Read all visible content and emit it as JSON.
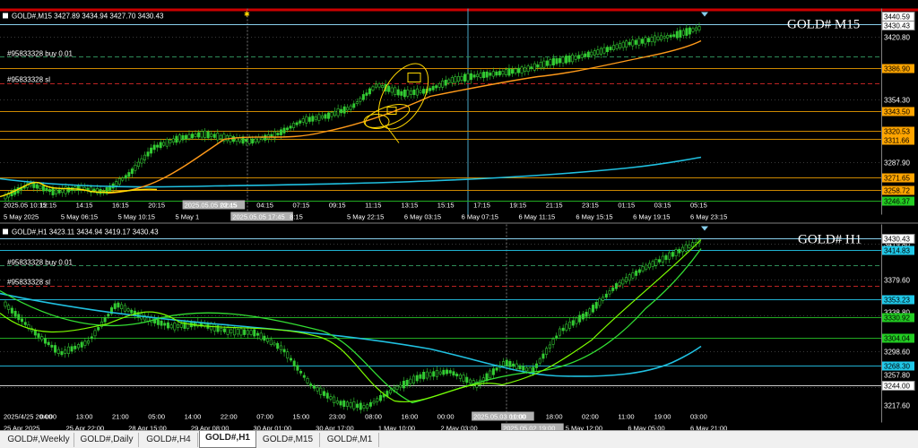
{
  "colors": {
    "background": "#000000",
    "grid": "#3a3a3a",
    "candle": "#33cc33",
    "ma_fast": "#7cfc00",
    "ma_orange": "#ff9a1a",
    "ma_cyan": "#20c0e0",
    "price_tag": "#ffffff",
    "tab_bar": "#f0f0f0"
  },
  "top_chart": {
    "info_text": "GOLD#,M15  3427.89 3434.94 3427.70 3430.43",
    "symbol_label": "GOLD# M15",
    "order_buy": "#95833328 buy 0.01",
    "order_sl": "#95833328 sl",
    "y_labels": [
      "3420.80",
      "3354.30",
      "3287.90"
    ],
    "price_tags": [
      {
        "value": "3440.59",
        "style": "white-box"
      },
      {
        "value": "3430.43",
        "style": "white-box"
      },
      {
        "value": "3386.90",
        "style": "orange"
      },
      {
        "value": "3343.50",
        "style": "orange"
      },
      {
        "value": "3320.53",
        "style": "orange"
      },
      {
        "value": "3311.66",
        "style": "orange"
      },
      {
        "value": "3271.65",
        "style": "orange"
      },
      {
        "value": "3258.72",
        "style": "orange"
      },
      {
        "value": "3246.37",
        "style": "green"
      }
    ],
    "x_labels_upper": [
      "2025.05 10:15",
      "12:15",
      "14:15",
      "16:15",
      "20:15",
      "2025.05.05 23:45",
      "02:15",
      "04:15",
      "07:15",
      "09:15",
      "11:15",
      "13:15",
      "15:15",
      "17:15",
      "19:15",
      "21:15",
      "23:15",
      "01:15",
      "03:15",
      "05:15"
    ],
    "x_labels_lower": [
      "5 May 2025",
      "5 May 06:15",
      "5 May 10:15",
      "5 May 1",
      "2025.05.05 17:45",
      "8:15",
      "5 May 22:15",
      "6 May 03:15",
      "6 May 07:15",
      "6 May 11:15",
      "6 May 15:15",
      "6 May 19:15",
      "6 May 23:15"
    ]
  },
  "bottom_chart": {
    "info_text": "GOLD#,H1  3423.11 3434.94 3419.17 3430.43",
    "symbol_label": "GOLD# H1",
    "order_buy": "#95833328 buy 0.01",
    "order_sl": "#95833328 sl",
    "y_labels": [
      "3419.80",
      "3379.60",
      "3338.80",
      "3298.60",
      "3257.80",
      "3217.60"
    ],
    "price_tags": [
      {
        "value": "3430.43",
        "style": "white-box"
      },
      {
        "value": "3414.83",
        "style": "cyan"
      },
      {
        "value": "3353.23",
        "style": "cyan"
      },
      {
        "value": "3330.92",
        "style": "green"
      },
      {
        "value": "3304.04",
        "style": "green"
      },
      {
        "value": "3268.30",
        "style": "cyan"
      },
      {
        "value": "3244.00",
        "style": "white-box"
      }
    ],
    "x_labels_upper": [
      "2025/4/25 20:00",
      "04:00",
      "13:00",
      "21:00",
      "05:00",
      "14:00",
      "22:00",
      "07:00",
      "15:00",
      "23:00",
      "08:00",
      "16:00",
      "00:00",
      "2025.05.03 01:00",
      "10:00",
      "18:00",
      "02:00",
      "11:00",
      "19:00",
      "03:00"
    ],
    "x_labels_lower": [
      "25 Apr 2025",
      "25 Apr 22:00",
      "28 Apr 15:00",
      "29 Apr 08:00",
      "30 Apr 01:00",
      "30 Apr 17:00",
      "1 May 10:00",
      "2 May 03:00",
      "2025.05.02 19:00",
      "5 May 12:00",
      "6 May 05:00",
      "6 May 21:00"
    ]
  },
  "tabs": [
    {
      "label": "GOLD#,Weekly",
      "active": false
    },
    {
      "label": "GOLD#,Daily",
      "active": false
    },
    {
      "label": "GOLD#,H4",
      "active": false
    },
    {
      "label": "GOLD#,H1",
      "active": true
    },
    {
      "label": "GOLD#,M15",
      "active": false
    },
    {
      "label": "GOLD#,M1",
      "active": false
    }
  ]
}
